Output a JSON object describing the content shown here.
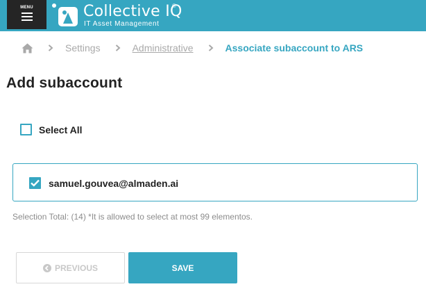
{
  "header": {
    "menu_label": "MENU",
    "brand_name": "Collective IQ",
    "brand_registered": "®",
    "brand_tagline": "IT Asset Management",
    "bar_color": "#36a6c1",
    "menu_bg": "#252525"
  },
  "breadcrumb": {
    "home_icon": "home-icon",
    "separator_icon": "chevron-right-icon",
    "items": [
      "Settings",
      "Administrative",
      "Associate subaccount to ARS"
    ]
  },
  "page": {
    "title": "Add subaccount"
  },
  "select_all": {
    "label": "Select All",
    "checked": false
  },
  "accounts": [
    {
      "email": "samuel.gouvea@almaden.ai",
      "checked": true
    }
  ],
  "selection_note": "Selection Total: (14) *It is allowed to select at most 99 elementos.",
  "buttons": {
    "previous_label": "PREVIOUS",
    "previous_icon": "arrow-left-circle-icon",
    "save_label": "SAVE"
  },
  "colors": {
    "accent": "#36a6c1",
    "muted_text": "#a9a9a9"
  }
}
